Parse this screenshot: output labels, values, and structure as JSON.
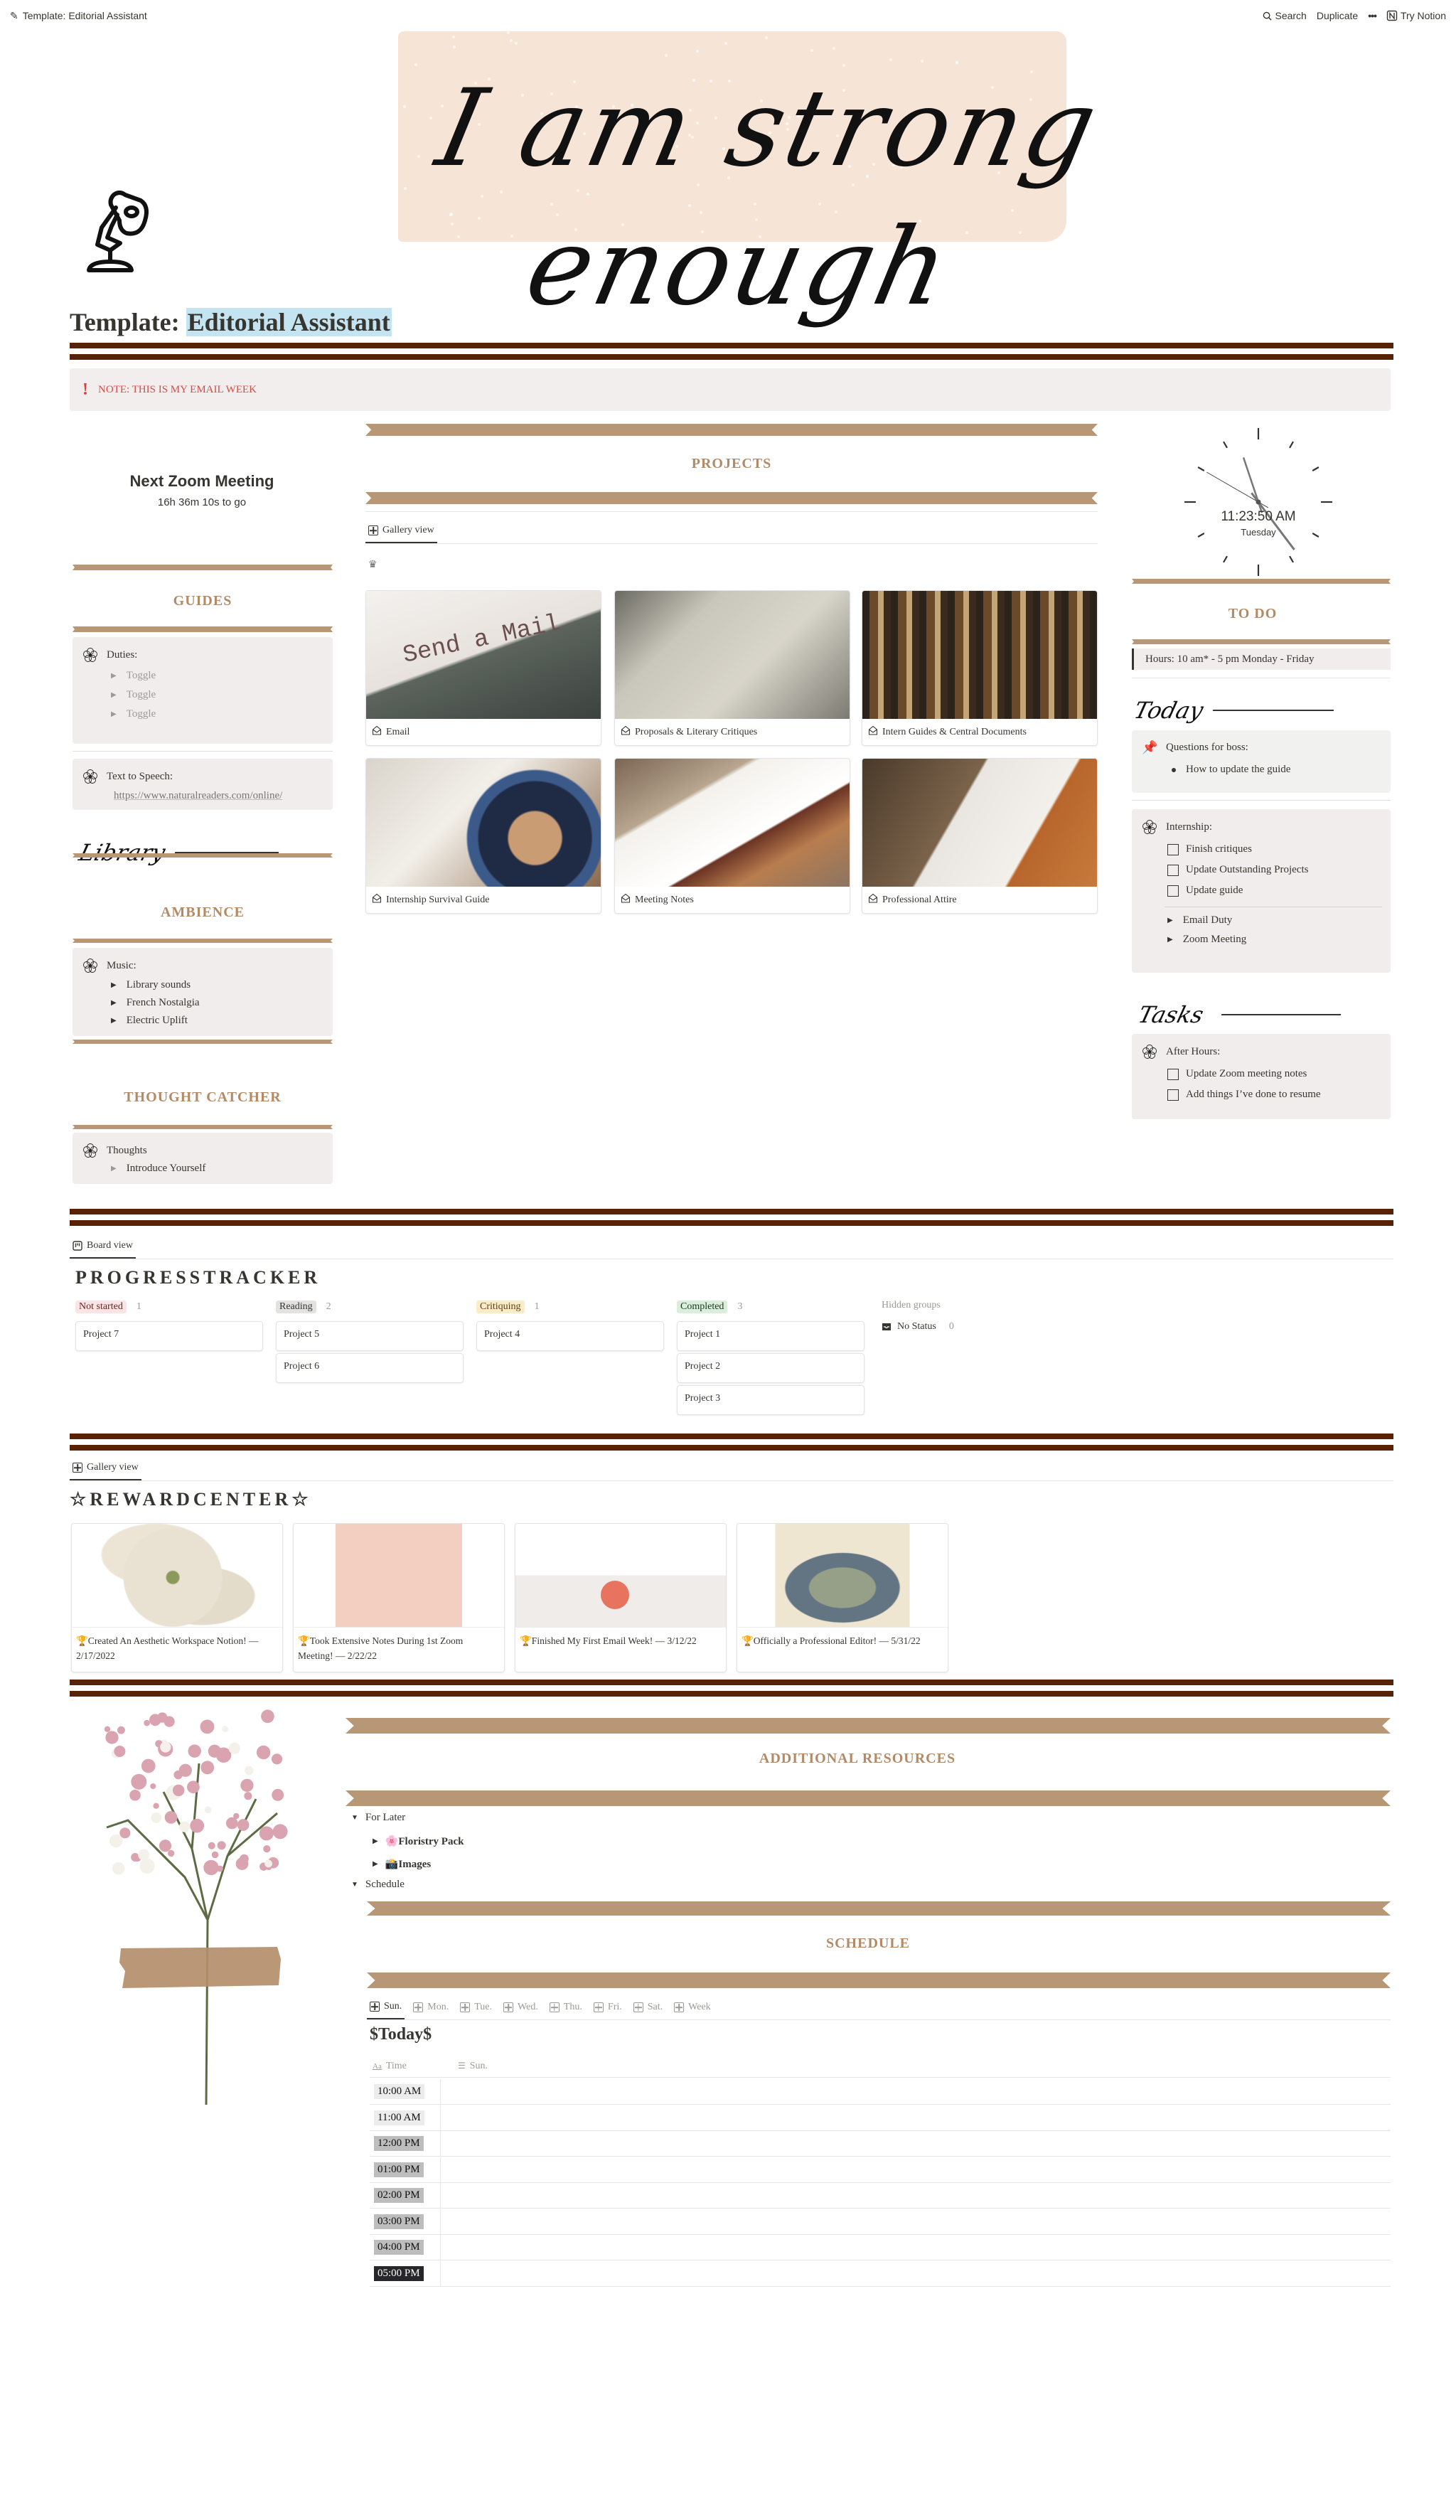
{
  "topbar": {
    "page_name": "Template: Editorial Assistant",
    "search_label": "Search",
    "duplicate_label": "Duplicate",
    "more_label": "•••",
    "try_notion_label": "Try Notion"
  },
  "cover": {
    "quote": "I am strong enough"
  },
  "page": {
    "title_prefix": "Template:",
    "title_highlight": "Editorial Assistant"
  },
  "note": {
    "icon": "!",
    "text": "NOTE: THIS IS MY EMAIL WEEK"
  },
  "left": {
    "zoom_title": "Next Zoom Meeting",
    "zoom_countdown": "16h 36m 10s to go",
    "guides_heading": "GUIDES",
    "duties_label": "Duties:",
    "duties_toggles": [
      "Toggle",
      "Toggle",
      "Toggle"
    ],
    "tts_label": "Text to Speech:",
    "tts_link": "https://www.naturalreaders.com/online/",
    "library_heading": "Library",
    "ambience_heading": "AMBIENCE",
    "music_label": "Music:",
    "music_items": [
      "Library sounds",
      "French Nostalgia",
      "Electric Uplift"
    ],
    "thought_heading": "THOUGHT CATCHER",
    "thoughts_label": "Thoughts",
    "thoughts_items": [
      "Introduce Yourself"
    ]
  },
  "projects": {
    "heading": "PROJECTS",
    "view_label": "Gallery view",
    "cards": [
      {
        "title": "Email"
      },
      {
        "title": "Proposals & Literary Critiques"
      },
      {
        "title": "Intern Guides & Central Documents"
      },
      {
        "title": "Internship Survival Guide"
      },
      {
        "title": "Meeting Notes"
      },
      {
        "title": "Professional Attire"
      }
    ]
  },
  "right": {
    "clock_time": "11:23:50 AM",
    "clock_day": "Tuesday",
    "todo_heading": "TO DO",
    "hours": "Hours: 10 am* - 5 pm Monday - Friday",
    "today_heading": "Today",
    "questions_label": "Questions for boss:",
    "questions_items": [
      "How to update the guide"
    ],
    "internship_label": "Internship:",
    "internship_tasks": [
      "Finish critiques",
      "Update Outstanding Projects",
      "Update guide"
    ],
    "internship_toggles": [
      "Email Duty",
      "Zoom Meeting"
    ],
    "tasks_heading": "Tasks",
    "after_hours_label": "After Hours:",
    "after_hours_tasks": [
      "Update Zoom meeting notes",
      "Add things I’ve done to resume"
    ]
  },
  "tracker": {
    "view_label": "Board view",
    "title": "PROGRESSTRACKER",
    "columns": [
      {
        "label": "Not started",
        "count": "1",
        "bg": "#fbe4e4",
        "fg": "#6a2424",
        "cards": [
          "Project 7"
        ]
      },
      {
        "label": "Reading",
        "count": "2",
        "bg": "#e3e2e0",
        "fg": "#37352f",
        "cards": [
          "Project 5",
          "Project 6"
        ]
      },
      {
        "label": "Critiquing",
        "count": "1",
        "bg": "#fbecc9",
        "fg": "#5a4215",
        "cards": [
          "Project 4"
        ]
      },
      {
        "label": "Completed",
        "count": "3",
        "bg": "#dbeddb",
        "fg": "#1c3829",
        "cards": [
          "Project 1",
          "Project 2",
          "Project 3"
        ]
      }
    ],
    "hidden_groups_label": "Hidden groups",
    "no_status_label": "No Status",
    "no_status_count": "0"
  },
  "rewards": {
    "view_label": "Gallery view",
    "title": "☆REWARDCENTER☆",
    "cards": [
      {
        "title": "🏆Created An Aesthetic Workspace Notion! — 2/17/2022"
      },
      {
        "title": "🏆Took Extensive Notes During 1st Zoom Meeting! — 2/22/22"
      },
      {
        "title": "🏆Finished My First Email Week! — 3/12/22"
      },
      {
        "title": "🏆Officially a Professional Editor! — 5/31/22"
      }
    ]
  },
  "resources": {
    "heading": "ADDITIONAL RESOURCES",
    "for_later_label": "For Later",
    "floristry_label": "🌸Floristry Pack",
    "images_label": "📸Images",
    "schedule_toggle_label": "Schedule"
  },
  "schedule": {
    "heading": "SCHEDULE",
    "tabs": [
      "Sun.",
      "Mon.",
      "Tue.",
      "Wed.",
      "Thu.",
      "Fri.",
      "Sat.",
      "Week"
    ],
    "active_tab": "Sun.",
    "table_title": "$Today$",
    "col_time": "Time",
    "col_day": "Sun.",
    "rows": [
      {
        "time": "10:00 AM",
        "style": "light"
      },
      {
        "time": "11:00 AM",
        "style": "light"
      },
      {
        "time": "12:00 PM",
        "style": "mid"
      },
      {
        "time": "01:00 PM",
        "style": "mid"
      },
      {
        "time": "02:00 PM",
        "style": "mid"
      },
      {
        "time": "03:00 PM",
        "style": "mid"
      },
      {
        "time": "04:00 PM",
        "style": "mid"
      },
      {
        "time": "05:00 PM",
        "style": "dark"
      }
    ]
  },
  "colors": {
    "accent_brown": "#b79775",
    "heading_tan": "#b38a66",
    "rule_dark_brown": "#5a2205",
    "callout_bg": "#f1eded",
    "note_red": "#d44c47"
  }
}
